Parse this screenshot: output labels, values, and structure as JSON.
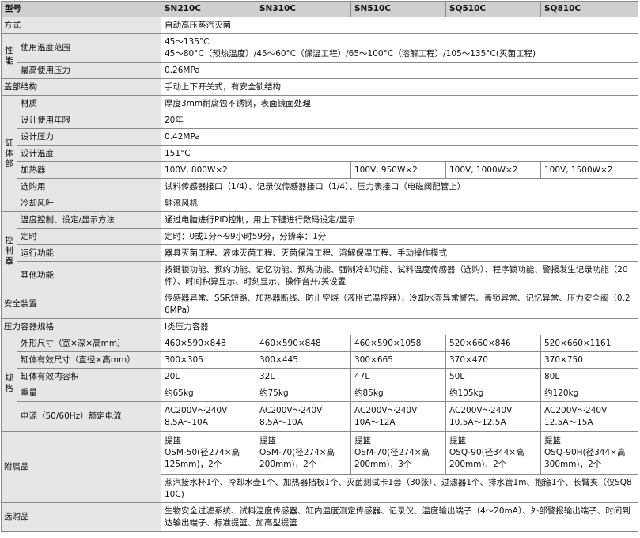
{
  "header": {
    "model": "型号",
    "models": [
      "SN210C",
      "SN310C",
      "SN510C",
      "SQ510C",
      "SQ810C"
    ]
  },
  "method": {
    "label": "方式",
    "value": "自动高压蒸汽灭菌"
  },
  "performance": {
    "category": "性能",
    "temp_range": {
      "label": "使用温度范围",
      "line1": "45～135°C",
      "line2": "45～80°C（预热温度）/45～60°C（保温工程）/65～100°C（溶解工程）/105～135°C(灭菌工程)"
    },
    "max_pressure": {
      "label": "最高使用压力",
      "value": "0.26MPa"
    }
  },
  "lid": {
    "label": "盖部结构",
    "value": "手动上下开关式，有安全锁结构"
  },
  "tank": {
    "category": "缸体部",
    "material": {
      "label": "材质",
      "value": "厚度3mm耐腐蚀不锈钢，表面镜面处理"
    },
    "design_life": {
      "label": "设计使用年限",
      "value": "20年"
    },
    "design_pressure": {
      "label": "设计压力",
      "value": "0.42MPa"
    },
    "design_temp": {
      "label": "设计温度",
      "value": "151°C"
    },
    "heater": {
      "label": "加热器",
      "v12": "100V, 800W×2",
      "v3": "100V, 950W×2",
      "v4": "100V, 1000W×2",
      "v5": "100V, 1500W×2"
    },
    "options": {
      "label": "选购用",
      "value": "试料传感器接口（1/4）、记录仪传感器接口（1/4）、压力表接口（电磁阀配管上）"
    },
    "cooling": {
      "label": "冷却风叶",
      "value": "轴流风机"
    }
  },
  "control": {
    "category": "控制器",
    "temp_control": {
      "label": "温度控制、设定/显示方法",
      "value": "通过电脑进行PID控制，用上下键进行数码设定/显示"
    },
    "timer": {
      "label": "定时",
      "value": "定时：0或1分～99小时59分，分辨率：1分"
    },
    "run": {
      "label": "运行功能",
      "value": "器具灭菌工程、液体灭菌工程、灭菌保温工程、溶解保温工程、手动操作模式"
    },
    "other": {
      "label": "其他功能",
      "value": "按键锁功能、预约功能、记忆功能、预热功能、强制冷却功能、试料温度传感器（选购）、程序锁功能、警报发生记录功能（20件）、时间积算显示、时刻显示、操作音开/关设置"
    }
  },
  "safety": {
    "label": "安全装置",
    "value": "传感器异常、SSR短路、加热器断线、防止空烧（液胀式温控器），冷却水壶异常警告、盖锁异常、记忆异常、压力安全阀（0.26MPa）"
  },
  "pressure_vessel": {
    "label": "压力容器规格",
    "value": "Ⅰ类压力容器"
  },
  "spec": {
    "category": "规格",
    "outer": {
      "label": "外形尺寸（宽×深×高mm）",
      "values": [
        "460×590×848",
        "460×590×848",
        "460×590×1058",
        "520×660×846",
        "520×660×1161"
      ]
    },
    "tank_size": {
      "label": "缸体有效尺寸（直径×高mm）",
      "values": [
        "300×305",
        "300×445",
        "300×665",
        "370×470",
        "370×750"
      ]
    },
    "volume": {
      "label": "缸体有效内容积",
      "values": [
        "20L",
        "32L",
        "47L",
        "50L",
        "80L"
      ]
    },
    "weight": {
      "label": "重量",
      "values": [
        "约65kg",
        "约75kg",
        "约85kg",
        "约105kg",
        "约120kg"
      ]
    },
    "power": {
      "label": "电源（50/60Hz）额定电流",
      "values": [
        {
          "v": "AC200V～240V",
          "a": "8.5A～10A"
        },
        {
          "v": "AC200V～240V",
          "a": "8.5A～10A"
        },
        {
          "v": "AC200V～240V",
          "a": "10A～12A"
        },
        {
          "v": "AC200V～240V",
          "a": "10.5A～12.5A"
        },
        {
          "v": "AC200V～240V",
          "a": "12.5A～15A"
        }
      ]
    }
  },
  "accessories": {
    "label": "附属品",
    "basket": [
      {
        "l1": "提篮",
        "l2": "OSM-50(径274×高",
        "l3": "125mm)，2个"
      },
      {
        "l1": "提篮",
        "l2": "OSM-70(径274×高",
        "l3": "200mm)，2个"
      },
      {
        "l1": "提篮",
        "l2": "OSM-70(径274×高",
        "l3": "200mm)，3个"
      },
      {
        "l1": "提篮",
        "l2": "OSQ-90(径344×高",
        "l3": "200mm)，2个"
      },
      {
        "l1": "提篮",
        "l2": "OSQ-90H(径344×高",
        "l3": "300mm)，2个"
      }
    ],
    "others": "蒸汽接水杯1个、冷却水壶1个、加热器挡板1个、灭菌测试卡1套（30张）、过滤器1个、排水管1m、抱箍1个、长臂夹（仅SQ810C)"
  },
  "optional": {
    "label": "选购品",
    "value": "生物安全过滤系统、试料温度传感器、缸内温度测定传感器、记录仪、温度输出端子（4～20mA）、外部警报输出端子、时间到达输出端子、标准提篮、加高型提篮"
  }
}
